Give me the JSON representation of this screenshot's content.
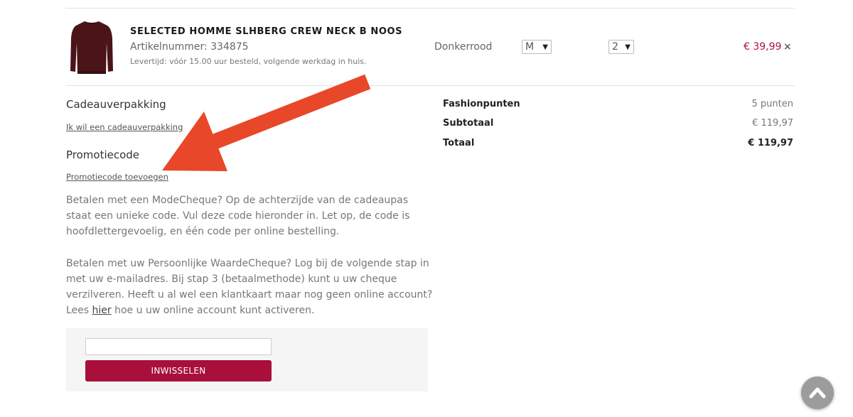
{
  "cart": {
    "item": {
      "name": "SELECTED HOMME SLHBERG CREW NECK B NOOS",
      "article": "Artikelnummer: 334875",
      "delivery": "Levertijd: vóór 15.00 uur besteld, volgende werkdag in huis.",
      "color": "Donkerrood",
      "size": "M",
      "quantity": "2",
      "price": "€ 39,99",
      "remove": "×"
    }
  },
  "gift": {
    "heading": "Cadeauverpakking",
    "link": "Ik wil een cadeauverpakking"
  },
  "promo": {
    "heading": "Promotiecode",
    "link": "Promotiecode toevoegen",
    "para1": "Betalen met een ModeCheque? Op de achterzijde van de cadeaupas staat een unieke code. Vul deze code hieronder in. Let op, de code is hoofdlettergevoelig, en één code per online bestelling.",
    "para2_before": "Betalen met uw Persoonlijke WaardeCheque? Log bij de volgende stap in met uw e-mailadres. Bij stap 3 (betaalmethode) kunt u uw cheque verzilveren. Heeft u al wel een klantkaart maar nog geen online account? Lees ",
    "para2_link": "hier",
    "para2_after": " hoe u uw online account kunt activeren.",
    "input_value": "",
    "button": "INWISSELEN"
  },
  "totals": {
    "points_label": "Fashionpunten",
    "points_value": "5 punten",
    "subtotal_label": "Subtotaal",
    "subtotal_value": "€ 119,97",
    "total_label": "Totaal",
    "total_value": "€ 119,97"
  },
  "colors": {
    "accent": "#a8103b",
    "price": "#b01040",
    "arrow": "#e8472a"
  },
  "icons": {
    "scroll_top": "chevron-up-icon",
    "remove": "close-icon"
  }
}
